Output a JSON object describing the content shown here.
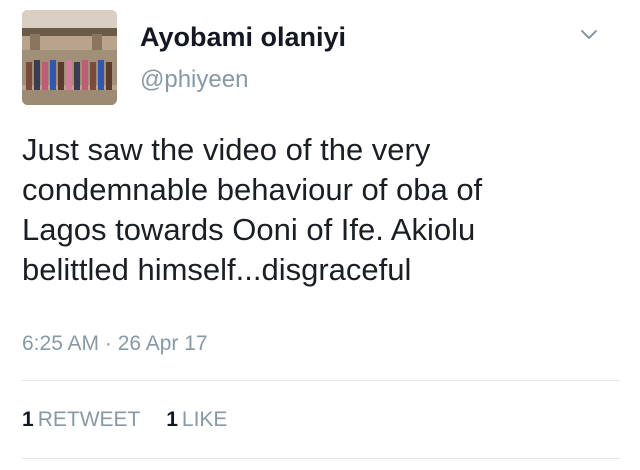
{
  "tweet": {
    "author": {
      "display_name": "Ayobami olaniyi",
      "handle": "@phiyeen",
      "avatar_icon": "group-photo-avatar"
    },
    "menu_icon": "chevron-down-icon",
    "text_lines": [
      "Just saw the video of the very",
      "condemnable behaviour of oba of",
      "Lagos towards Ooni of Ife. Akiolu",
      "belittled himself...disgraceful"
    ],
    "timestamp": "6:25 AM · 26 Apr 17",
    "stats": {
      "retweets": {
        "count": "1",
        "label": "RETWEET"
      },
      "likes": {
        "count": "1",
        "label": "LIKE"
      }
    }
  },
  "colors": {
    "name": "#141823",
    "secondary": "#8899a6",
    "divider": "#e1e8ed"
  }
}
